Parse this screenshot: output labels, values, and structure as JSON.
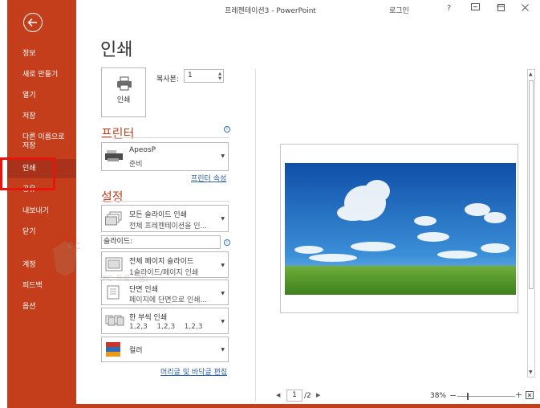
{
  "window": {
    "title": "프레젠테이션3  -  PowerPoint",
    "login": "로그인",
    "help": "?"
  },
  "sidebar": {
    "items": [
      {
        "label": "정보"
      },
      {
        "label": "새로 만들기"
      },
      {
        "label": "열기"
      },
      {
        "label": "저장"
      },
      {
        "label": "다른 이름으로 저장"
      },
      {
        "label": "인쇄"
      },
      {
        "label": "공유"
      },
      {
        "label": "내보내기"
      },
      {
        "label": "닫기"
      },
      {
        "label": "계정"
      },
      {
        "label": "피드백"
      },
      {
        "label": "옵션"
      }
    ]
  },
  "print": {
    "heading": "인쇄",
    "button_label": "인쇄",
    "copies_label": "복사본:",
    "copies_value": "1"
  },
  "printer": {
    "section_title": "프린터",
    "name": "ApeosP",
    "status": "준비",
    "properties_link": "프린터 속성"
  },
  "settings": {
    "section_title": "설정",
    "range": {
      "title": "모든 슬라이드 인쇄",
      "desc": "전체 프레젠테이션을 인..."
    },
    "slides_label": "슬라이드:",
    "layout": {
      "title": "전체 페이지 슬라이드",
      "desc": "1슬라이드/페이지 인쇄"
    },
    "sides": {
      "title": "단면 인쇄",
      "desc": "페이지에 단면으로 인쇄..."
    },
    "collate": {
      "title": "한 부씩 인쇄",
      "desc": "1,2,3    1,2,3    1,2,3"
    },
    "color": {
      "title": "컬러"
    },
    "header_footer_link": "머리글 및 바닥글 편집"
  },
  "preview": {
    "current_page": "1",
    "total_pages": "/2",
    "zoom": "38%"
  },
  "watermark": {
    "text": "PC",
    "subtext": "(PC 프로그램)"
  },
  "colors": {
    "accent": "#c43e1c",
    "highlight_box": "#e8150c",
    "link": "#2d5fa8"
  }
}
